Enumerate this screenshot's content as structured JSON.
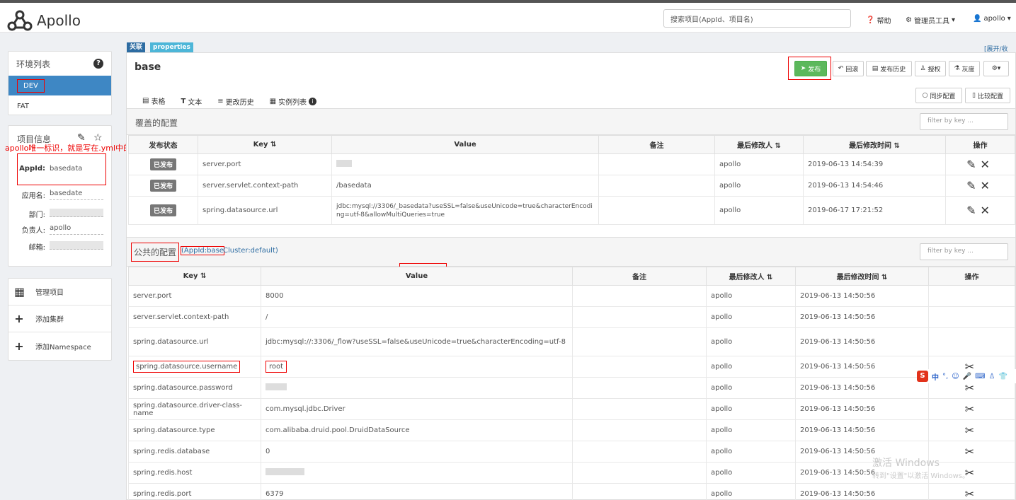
{
  "header": {
    "app_name": "Apollo",
    "search_placeholder": "搜索项目(AppId、项目名)",
    "help": "帮助",
    "admin_tools": "管理员工具",
    "user": "apollo"
  },
  "env": {
    "title": "环境列表",
    "items": [
      "DEV",
      "FAT"
    ]
  },
  "project": {
    "title": "项目信息",
    "annotation": "apollo唯一标识，就是写在.yml中的",
    "fields": [
      {
        "label": "AppId:",
        "value": "basedata"
      },
      {
        "label": "应用名:",
        "value": "basedate"
      },
      {
        "label": "部门:",
        "value": ""
      },
      {
        "label": "负责人:",
        "value": "apollo"
      },
      {
        "label": "邮箱:",
        "value": ""
      }
    ]
  },
  "menu": [
    {
      "label": "管理项目"
    },
    {
      "label": "添加集群"
    },
    {
      "label": "添加Namespace"
    }
  ],
  "namespace": {
    "tag_link": "关联",
    "tag_format": "properties",
    "name": "base",
    "expand": "[展开/收缩]"
  },
  "toolbar": {
    "publish": "发布",
    "rollback": "回滚",
    "history": "发布历史",
    "grant": "授权",
    "gray": "灰度",
    "sync": "同步配置",
    "compare": "比较配置"
  },
  "tabs": [
    "表格",
    "文本",
    "更改历史",
    "实例列表"
  ],
  "override": {
    "title": "覆盖的配置",
    "filter": "filter by key ...",
    "headers": [
      "发布状态",
      "Key",
      "Value",
      "备注",
      "最后修改人",
      "最后修改时间",
      "操作"
    ],
    "rows": [
      {
        "status": "已发布",
        "key": "server.port",
        "value": "",
        "comment": "",
        "modifier": "apollo",
        "time": "2019-06-13 14:54:39"
      },
      {
        "status": "已发布",
        "key": "server.servlet.context-path",
        "value": "/basedata",
        "comment": "",
        "modifier": "apollo",
        "time": "2019-06-13 14:54:46"
      },
      {
        "status": "已发布",
        "key": "spring.datasource.url",
        "value": "jdbc:mysql://3306/_basedata?useSSL=false&useUnicode=true&characterEncoding=utf-8&allowMultiQueries=true",
        "comment": "",
        "modifier": "apollo",
        "time": "2019-06-17 17:21:52"
      }
    ]
  },
  "public": {
    "title": "公共的配置",
    "appid": "(AppId:base",
    "cluster": "Cluster:default)",
    "filter": "filter by key ...",
    "headers": [
      "Key",
      "Value",
      "备注",
      "最后修改人",
      "最后修改时间",
      "操作"
    ],
    "rows": [
      {
        "key": "server.port",
        "value": "8000",
        "comment": "",
        "modifier": "apollo",
        "time": "2019-06-13 14:50:56"
      },
      {
        "key": "server.servlet.context-path",
        "value": "/",
        "comment": "",
        "modifier": "apollo",
        "time": "2019-06-13 14:50:56"
      },
      {
        "key": "spring.datasource.url",
        "value": "jdbc:mysql://:3306/_flow?useSSL=false&useUnicode=true&characterEncoding=utf-8",
        "comment": "",
        "modifier": "apollo",
        "time": "2019-06-13 14:50:56"
      },
      {
        "key": "spring.datasource.username",
        "value": "root",
        "comment": "",
        "modifier": "apollo",
        "time": "2019-06-13 14:50:56"
      },
      {
        "key": "spring.datasource.password",
        "value": "",
        "comment": "",
        "modifier": "apollo",
        "time": "2019-06-13 14:50:56"
      },
      {
        "key": "spring.datasource.driver-class-name",
        "value": "com.mysql.jdbc.Driver",
        "comment": "",
        "modifier": "apollo",
        "time": "2019-06-13 14:50:56"
      },
      {
        "key": "spring.datasource.type",
        "value": "com.alibaba.druid.pool.DruidDataSource",
        "comment": "",
        "modifier": "apollo",
        "time": "2019-06-13 14:50:56"
      },
      {
        "key": "spring.redis.database",
        "value": "0",
        "comment": "",
        "modifier": "apollo",
        "time": "2019-06-13 14:50:56"
      },
      {
        "key": "spring.redis.host",
        "value": "",
        "comment": "",
        "modifier": "apollo",
        "time": "2019-06-13 14:50:56"
      },
      {
        "key": "spring.redis.port",
        "value": "6379",
        "comment": "",
        "modifier": "apollo",
        "time": "2019-06-13 14:50:56"
      }
    ]
  },
  "watermark": {
    "line1": "激活 Windows",
    "line2": "转到\"设置\"以激活 Windows。"
  },
  "ime": {
    "label": "中"
  }
}
